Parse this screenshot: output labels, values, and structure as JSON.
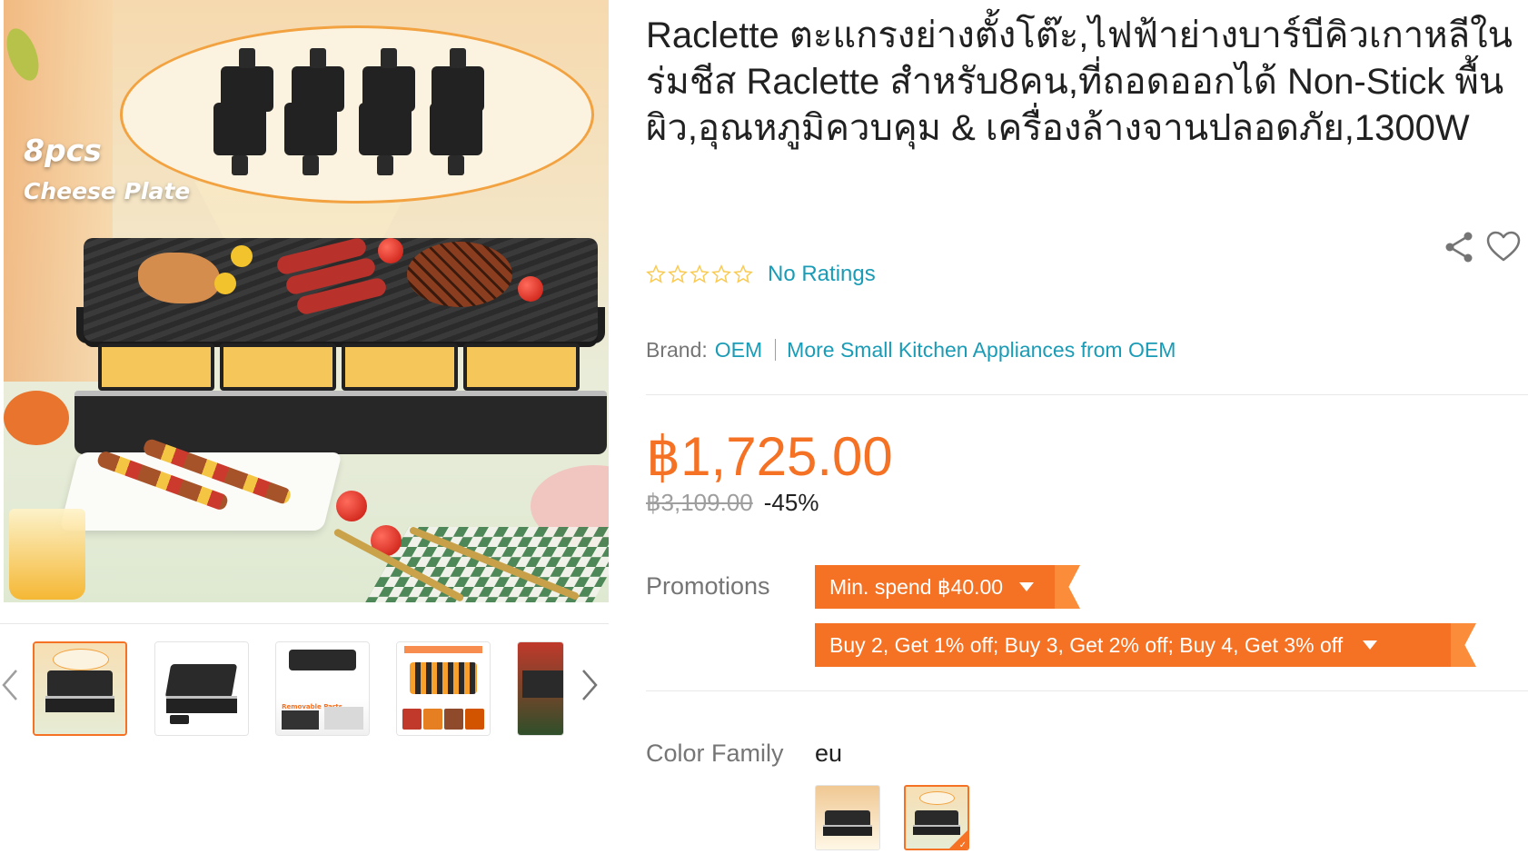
{
  "product": {
    "title": "Raclette ตะแกรงย่างตั้งโต๊ะ,ไฟฟ้าย่างบาร์บีคิวเกาหลีในร่มชีส Raclette สำหรับ8คน,ที่ถอดออกได้ Non-Stick พื้นผิว,อุณหภูมิควบคุม & เครื่องล้างจานปลอดภัย,1300W",
    "ratings_text": "No Ratings",
    "brand_label": "Brand:",
    "brand_name": "OEM",
    "more_link": "More Small Kitchen Appliances from OEM",
    "price": "฿1,725.00",
    "original_price": "฿3,109.00",
    "discount": "-45%"
  },
  "main_image": {
    "overlay_line1": "8pcs",
    "overlay_line2": "Cheese Plate"
  },
  "thumbnails": [
    {
      "label": "",
      "active": true
    },
    {
      "label": "",
      "active": false
    },
    {
      "label": "Removable Parts",
      "active": false
    },
    {
      "label": "",
      "active": false
    },
    {
      "label": "",
      "active": false
    }
  ],
  "promotions": {
    "label": "Promotions",
    "tags": [
      "Min. spend ฿40.00",
      "Buy 2, Get 1% off; Buy 3, Get 2% off; Buy 4, Get 3% off"
    ]
  },
  "color_family": {
    "label": "Color Family",
    "selected_value": "eu"
  },
  "icons": {
    "share": "share-icon",
    "wishlist": "heart-icon",
    "star": "star-outline-icon",
    "prev": "chevron-left-icon",
    "next": "chevron-right-icon"
  },
  "colors": {
    "accent": "#f57224",
    "link": "#1a9cb7",
    "muted": "#757575",
    "star": "#faca51"
  }
}
